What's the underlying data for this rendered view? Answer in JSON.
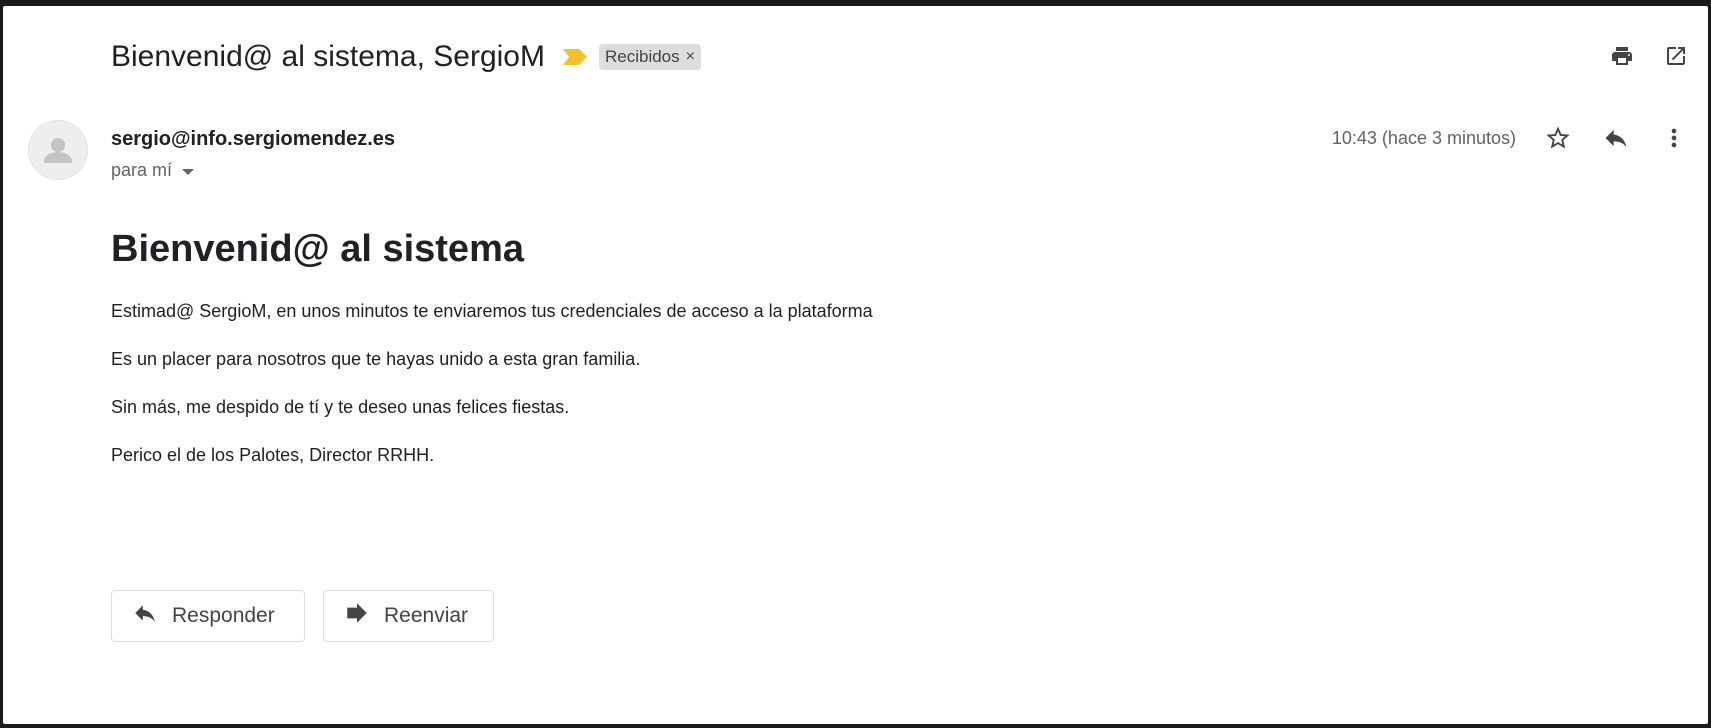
{
  "email": {
    "subject": "Bienvenid@ al sistema, SergioM",
    "label": {
      "name": "Recibidos",
      "remove_symbol": "×"
    },
    "importance_color": "#f6c026",
    "top_actions": [
      {
        "icon": "print-icon"
      },
      {
        "icon": "open-in-new-window-icon"
      }
    ],
    "sender": "sergio@info.sergiomendez.es",
    "recipients": "para mí",
    "timestamp": "10:43 (hace 3 minutos)",
    "meta_actions": [
      {
        "icon": "star-icon"
      },
      {
        "icon": "reply-icon"
      },
      {
        "icon": "more-vert-icon"
      }
    ],
    "body": {
      "heading": "Bienvenid@ al sistema",
      "paragraphs": [
        "Estimad@ SergioM, en unos minutos te enviaremos tus credenciales de acceso a la plataforma",
        "Es un placer para nosotros que te hayas unido a esta gran familia.",
        "Sin más, me despido de tí y te deseo unas felices fiestas.",
        "Perico el de los Palotes, Director RRHH."
      ]
    },
    "buttons": {
      "reply": "Responder",
      "forward": "Reenviar"
    }
  }
}
